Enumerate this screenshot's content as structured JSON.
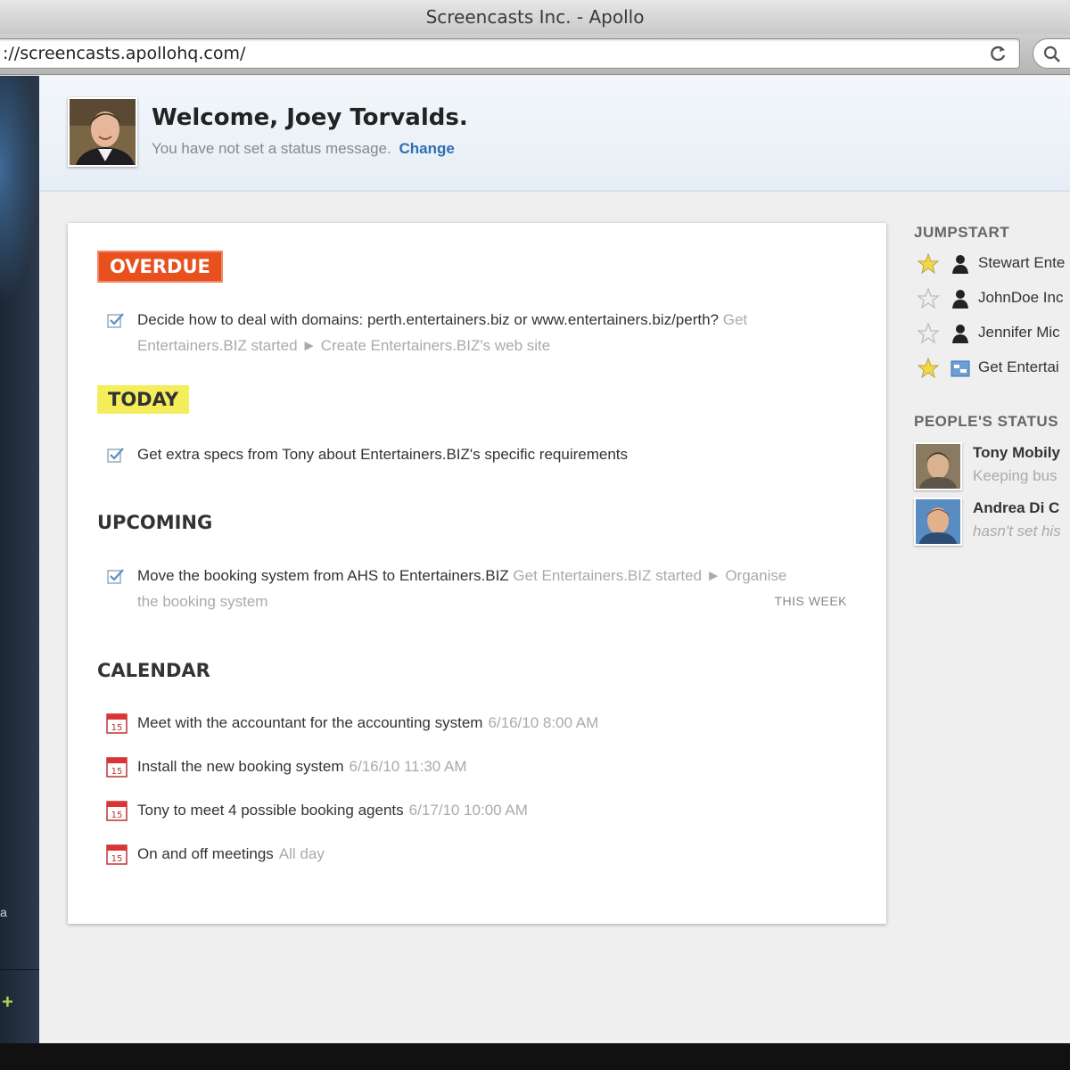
{
  "window": {
    "title": "Screencasts Inc. - Apollo"
  },
  "browser": {
    "url": "://screencasts.apollohq.com/"
  },
  "sidebar": {
    "partial_text": "a"
  },
  "header": {
    "welcome": "Welcome, Joey Torvalds.",
    "status_message": "You have not set a status message.",
    "change_label": "Change"
  },
  "overdue": {
    "badge": "OVERDUE",
    "tasks": [
      {
        "title": "Decide how to deal with domains: perth.entertainers.biz or www.entertainers.biz/perth?",
        "context": "Get Entertainers.BIZ started ► Create Entertainers.BIZ's web site"
      }
    ]
  },
  "today": {
    "badge": "TODAY",
    "tasks": [
      {
        "title": "Get extra specs from Tony about Entertainers.BIZ's specific requirements"
      }
    ]
  },
  "upcoming": {
    "heading": "UPCOMING",
    "tasks": [
      {
        "title": "Move the booking system from AHS to Entertainers.BIZ",
        "context": "Get Entertainers.BIZ started ► Organise the booking system",
        "when": "THIS WEEK"
      }
    ]
  },
  "calendar": {
    "heading": "CALENDAR",
    "events": [
      {
        "title": "Meet with the accountant for the accounting system",
        "time": "6/16/10 8:00 AM"
      },
      {
        "title": "Install the new booking system",
        "time": "6/16/10 11:30 AM"
      },
      {
        "title": "Tony to meet 4 possible booking agents",
        "time": "6/17/10 10:00 AM"
      },
      {
        "title": "On and off meetings",
        "time": "All day"
      }
    ]
  },
  "jumpstart": {
    "heading": "JUMPSTART",
    "items": [
      {
        "label": "Stewart Ente",
        "starred": true,
        "kind": "person"
      },
      {
        "label": "JohnDoe Inc",
        "starred": false,
        "kind": "person"
      },
      {
        "label": "Jennifer Mic",
        "starred": false,
        "kind": "person"
      },
      {
        "label": "Get Entertai",
        "starred": true,
        "kind": "project"
      }
    ]
  },
  "people_status": {
    "heading": "PEOPLE'S STATUS",
    "people": [
      {
        "name": "Tony Mobily",
        "status": "Keeping bus"
      },
      {
        "name": "Andrea Di C",
        "status": "hasn't set his"
      }
    ]
  },
  "colors": {
    "overdue": "#e8501e",
    "today": "#f4ee5c",
    "link": "#2f6fb0",
    "sidebar": "#1c2633"
  }
}
